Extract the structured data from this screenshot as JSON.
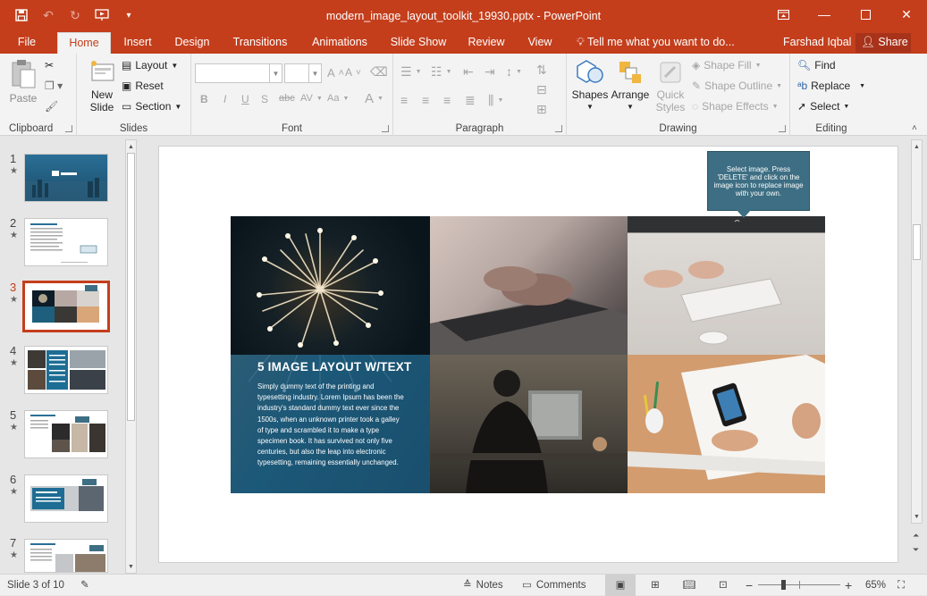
{
  "window": {
    "title": "modern_image_layout_toolkit_19930.pptx - PowerPoint",
    "user": "Farshad Iqbal",
    "share_label": "Share",
    "tell_me": "Tell me what you want to do..."
  },
  "tabs": [
    {
      "label": "File"
    },
    {
      "label": "Home"
    },
    {
      "label": "Insert"
    },
    {
      "label": "Design"
    },
    {
      "label": "Transitions"
    },
    {
      "label": "Animations"
    },
    {
      "label": "Slide Show"
    },
    {
      "label": "Review"
    },
    {
      "label": "View"
    }
  ],
  "ribbon": {
    "clipboard": {
      "label": "Clipboard",
      "paste": "Paste"
    },
    "slides": {
      "label": "Slides",
      "new_slide_1": "New",
      "new_slide_2": "Slide",
      "layout": "Layout",
      "reset": "Reset",
      "section": "Section"
    },
    "font": {
      "label": "Font",
      "bold": "B",
      "italic": "I",
      "underline": "U",
      "shadow": "S",
      "strike": "abc",
      "spacing": "AV",
      "case": "Aa"
    },
    "paragraph": {
      "label": "Paragraph"
    },
    "drawing": {
      "label": "Drawing",
      "shapes": "Shapes",
      "arrange": "Arrange",
      "quick_styles_1": "Quick",
      "quick_styles_2": "Styles",
      "shape_fill": "Shape Fill",
      "shape_outline": "Shape Outline",
      "shape_effects": "Shape Effects"
    },
    "editing": {
      "label": "Editing",
      "find": "Find",
      "replace": "Replace",
      "select": "Select"
    }
  },
  "thumbnails": [
    {
      "num": "1"
    },
    {
      "num": "2"
    },
    {
      "num": "3"
    },
    {
      "num": "4"
    },
    {
      "num": "5"
    },
    {
      "num": "6"
    },
    {
      "num": "7"
    }
  ],
  "slide": {
    "callout": "Select image. Press 'DELETE' and click on the image icon to replace image with your own.",
    "title": "5 IMAGE LAYOUT W/TEXT",
    "body": "Simply dummy text of the printing and typesetting industry. Lorem Ipsum has been the industry's standard dummy text ever since the 1500s, when an unknown printer took a galley of type and scrambled it to make a type specimen book. It has survived not only five centuries, but also the leap into electronic typesetting, remaining essentially unchanged."
  },
  "status": {
    "slide_info": "Slide 3 of 10",
    "notes": "Notes",
    "comments": "Comments",
    "zoom": "65%"
  },
  "colors": {
    "accent": "#c43e1c",
    "slide_blue": "#1d5f7c",
    "callout": "#3d6e83"
  }
}
